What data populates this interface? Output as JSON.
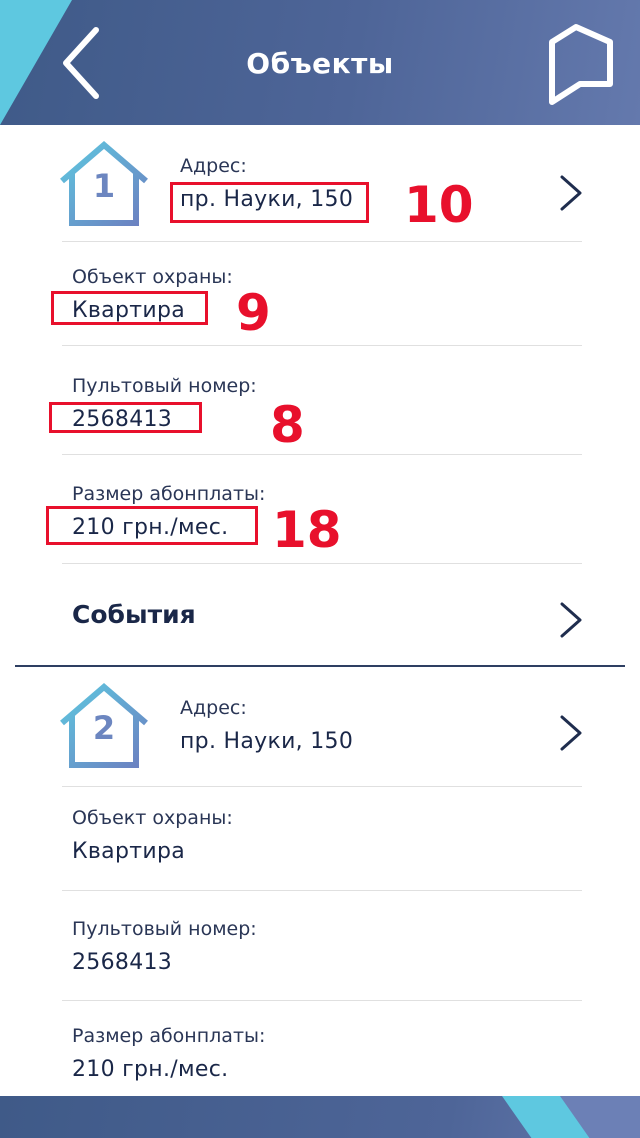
{
  "header": {
    "title": "Объекты",
    "back_icon": "chevron-left-icon",
    "action_icon": "flag-icon"
  },
  "objects": [
    {
      "number": "1",
      "address_label": "Адрес:",
      "address": "пр. Науки, 150",
      "guard_object_label": "Объект охраны:",
      "guard_object": "Квартира",
      "console_number_label": "Пультовый номер:",
      "console_number": "2568413",
      "fee_label": "Размер абонплаты:",
      "fee": "210 грн./мес.",
      "events_label": "События"
    },
    {
      "number": "2",
      "address_label": "Адрес:",
      "address": "пр. Науки, 150",
      "guard_object_label": "Объект охраны:",
      "guard_object": "Квартира",
      "console_number_label": "Пультовый номер:",
      "console_number": "2568413",
      "fee_label": "Размер абонплаты:",
      "fee": "210 грн./мес."
    }
  ],
  "annotations": {
    "address_mark": "10",
    "guard_object_mark": "9",
    "console_number_mark": "8",
    "fee_mark": "18",
    "color": "#e8102c"
  },
  "colors": {
    "header_dark": "#3f5a88",
    "header_light": "#6479ad",
    "accent_cyan": "#5ec8e0",
    "text_dark": "#1a2748"
  }
}
